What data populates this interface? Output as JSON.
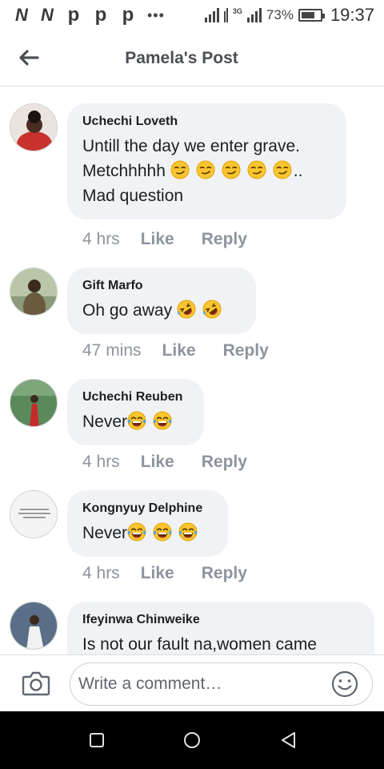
{
  "status_bar": {
    "apps": [
      "N",
      "N"
    ],
    "pins": [
      "p",
      "p",
      "p"
    ],
    "dots": "•••",
    "network": "3G",
    "battery_pct": "73%",
    "battery_level": 0.73,
    "time": "19:37"
  },
  "header": {
    "title": "Pamela's Post",
    "back_icon": "arrow-left-icon"
  },
  "actions": {
    "like": "Like",
    "reply": "Reply"
  },
  "comments": [
    {
      "author": "Uchechi Loveth",
      "lines": [
        "Untill the day we enter grave.",
        "Metchhhhh",
        "Mad question"
      ],
      "emoji": "smirk",
      "emoji_count": 5,
      "emoji_suffix": "..",
      "time": "4 hrs",
      "avatar_color": "#c8322d"
    },
    {
      "author": "Gift Marfo",
      "text": "Oh go away",
      "emoji": "rofl",
      "emoji_count": 2,
      "time": "47 mins",
      "avatar_color": "#6b5a3e"
    },
    {
      "author": "Uchechi Reuben",
      "text": "Never",
      "emoji": "joy",
      "emoji_count": 2,
      "time": "4 hrs",
      "avatar_color": "#3f7a4a"
    },
    {
      "author": "Kongnyuy Delphine",
      "text": "Never",
      "emoji": "joy",
      "emoji_count": 3,
      "time": "4 hrs",
      "avatar_color": "#f4f4f4"
    },
    {
      "author": "Ifeyinwa Chinweike",
      "text": "Is not our fault na,women came",
      "avatar_color": "#5a6f87"
    }
  ],
  "composer": {
    "placeholder": "Write a comment…",
    "camera_icon": "camera-icon",
    "emoji_icon": "smiley-icon"
  },
  "nav": {
    "icons": [
      "recents-square-icon",
      "home-circle-icon",
      "back-triangle-icon"
    ]
  },
  "colors": {
    "bubble_bg": "#f0f2f5",
    "meta_text": "#8d949e",
    "header_title": "#4b4f56",
    "divider": "#dadde1"
  }
}
